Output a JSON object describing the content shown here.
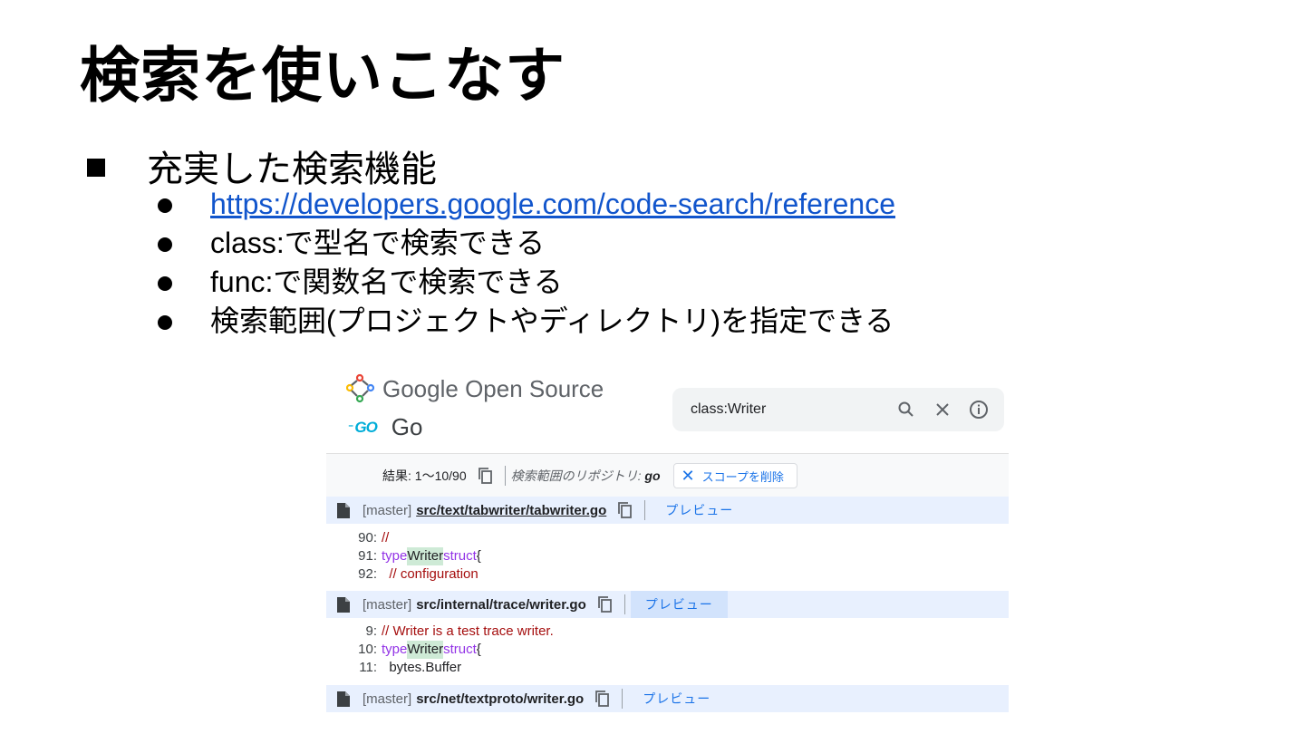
{
  "slide": {
    "title": "検索を使いこなす",
    "heading": "充実した検索機能",
    "bullets": [
      "https://developers.google.com/code-search/reference",
      "class:で型名で検索できる",
      "func:で関数名で検索できる",
      "検索範囲(プロジェクトやディレクトリ)を指定できる"
    ]
  },
  "screenshot": {
    "brand": "Google Open Source",
    "project": "Go",
    "project_logo": "GO",
    "search_query": "class:Writer",
    "results_count": "結果: 1〜10/90",
    "scope_label": "検索範囲のリポジトリ: ",
    "scope_value": "go",
    "remove_scope": "スコープを削除",
    "preview": "プレビュー",
    "results": [
      {
        "branch": "[master]",
        "path": "src/text/tabwriter/tabwriter.go",
        "lines": [
          {
            "n": "90:",
            "code": "//"
          },
          {
            "n": "91:",
            "kw1": "type",
            "hl": "Writer",
            "kw2": "struct",
            "tail": "{"
          },
          {
            "n": "92:",
            "code": "  // configuration"
          }
        ]
      },
      {
        "branch": "[master]",
        "path": "src/internal/trace/writer.go",
        "lines": [
          {
            "n": "9:",
            "code": "// Writer is a test trace writer."
          },
          {
            "n": "10:",
            "kw1": "type",
            "hl": "Writer",
            "kw2": "struct",
            "tail": "{"
          },
          {
            "n": "11:",
            "code": "  bytes.Buffer"
          }
        ]
      },
      {
        "branch": "[master]",
        "path": "src/net/textproto/writer.go"
      }
    ],
    "colors": {
      "link": "#1155cc",
      "accent": "#1a73e8",
      "header_bg": "#e8f0fe",
      "highlight": "#ceead6",
      "comment": "#a50e0e",
      "keyword": "#9334e6"
    }
  }
}
